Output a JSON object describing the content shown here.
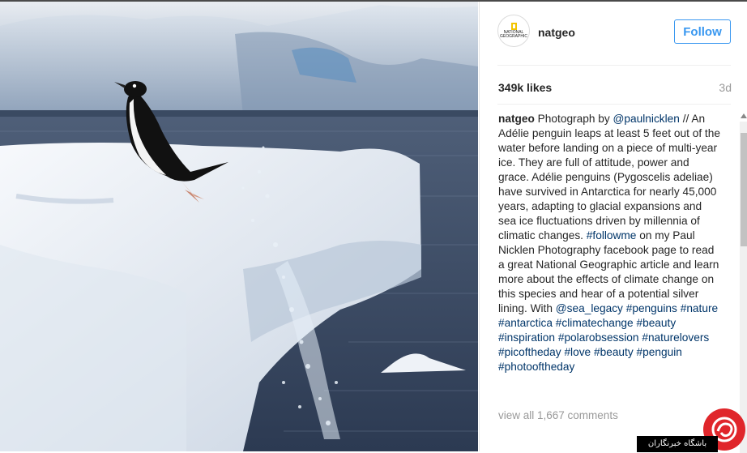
{
  "post": {
    "username": "natgeo",
    "follow_label": "Follow",
    "likes": "349k likes",
    "age": "3d",
    "avatar_text": "NATIONAL GEOGRAPHIC",
    "caption": {
      "author": "natgeo",
      "t1": " Photograph by ",
      "mention1": "@paulnicklen",
      "t2": " // An Adélie penguin leaps at least 5 feet out of the water before landing on a piece of multi-year ice. They are full of attitude, power and grace. Adélie penguins (Pygoscelis adeliae) have survived in Antarctica for nearly 45,000 years, adapting to glacial expansions and sea ice fluctuations driven by millennia of climatic changes. ",
      "tag_followme": "#followme",
      "t3": " on my Paul Nicklen Photography facebook page to read a great National Geographic article and learn more about the effects of climate change on this species and hear of a potential silver lining. With ",
      "mention2": "@sea_legacy",
      "tags": [
        "#penguins",
        "#nature",
        "#antarctica",
        "#climatechange",
        "#beauty",
        "#inspiration",
        "#polarobsession",
        "#naturelovers",
        "#picoftheday",
        "#love",
        "#beauty",
        "#penguin",
        "#photooftheday"
      ]
    },
    "view_all": "view all 1,667 comments"
  },
  "watermark": {
    "text": "باشگاه خبرنگاران"
  },
  "colors": {
    "link": "#003569",
    "follow": "#3897f0",
    "watermark_red": "#e0262b"
  }
}
